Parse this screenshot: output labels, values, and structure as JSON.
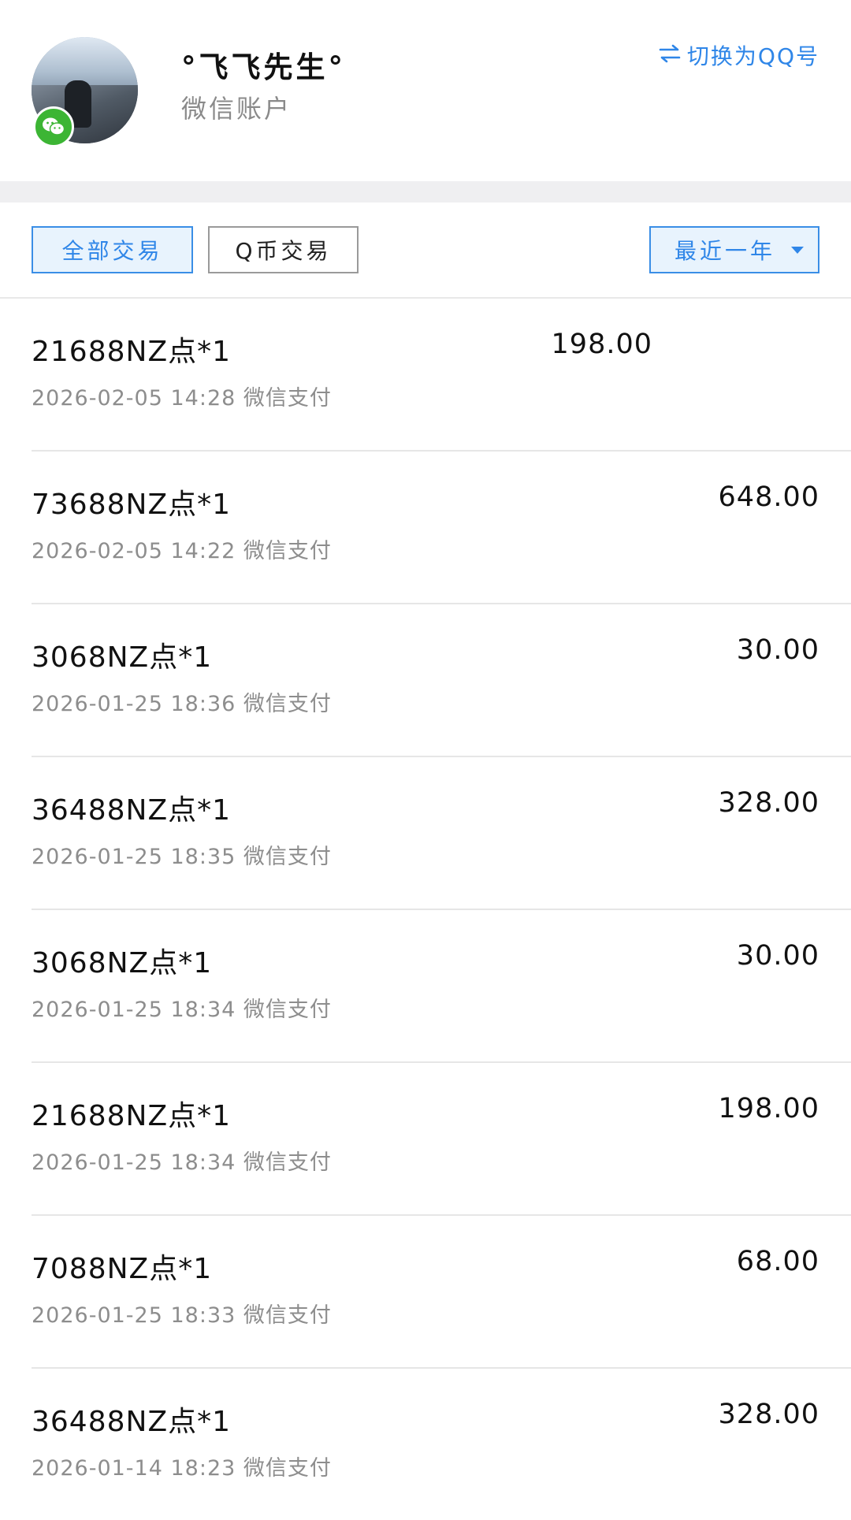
{
  "header": {
    "nickname": "°飞飞先生°",
    "account_type": "微信账户",
    "switch_label": "切换为QQ号",
    "switch_icon": "swap-arrows-icon",
    "badge_icon": "wechat-icon"
  },
  "filters": {
    "tab_all": "全部交易",
    "tab_qcoin": "Q币交易",
    "range_label": "最近一年"
  },
  "colors": {
    "accent": "#2f86e8",
    "accent_bg": "#e8f3fd",
    "wechat_green": "#3cb534"
  },
  "transactions": [
    {
      "name": "21688NZ点*1",
      "datetime": "2026-02-05 14:28",
      "method": "微信支付",
      "amount": "198.00"
    },
    {
      "name": "73688NZ点*1",
      "datetime": "2026-02-05 14:22",
      "method": "微信支付",
      "amount": "648.00"
    },
    {
      "name": "3068NZ点*1",
      "datetime": "2026-01-25 18:36",
      "method": "微信支付",
      "amount": "30.00"
    },
    {
      "name": "36488NZ点*1",
      "datetime": "2026-01-25 18:35",
      "method": "微信支付",
      "amount": "328.00"
    },
    {
      "name": "3068NZ点*1",
      "datetime": "2026-01-25 18:34",
      "method": "微信支付",
      "amount": "30.00"
    },
    {
      "name": "21688NZ点*1",
      "datetime": "2026-01-25 18:34",
      "method": "微信支付",
      "amount": "198.00"
    },
    {
      "name": "7088NZ点*1",
      "datetime": "2026-01-25 18:33",
      "method": "微信支付",
      "amount": "68.00"
    },
    {
      "name": "36488NZ点*1",
      "datetime": "2026-01-14 18:23",
      "method": "微信支付",
      "amount": "328.00"
    }
  ]
}
